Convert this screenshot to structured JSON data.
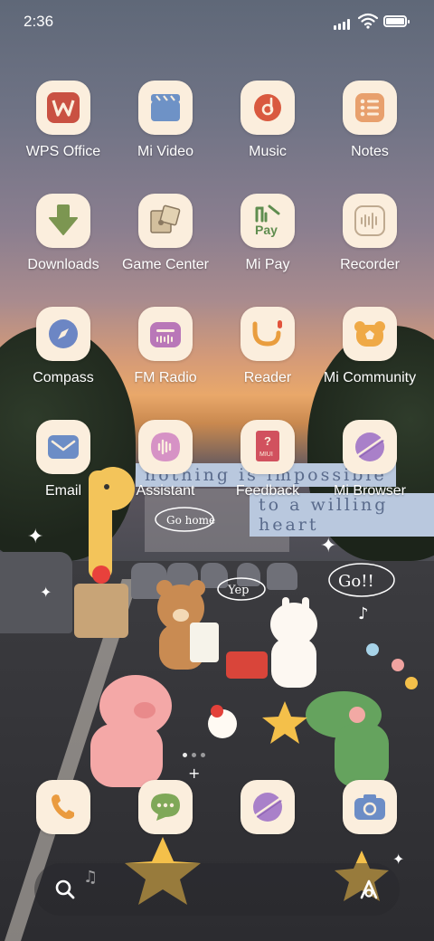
{
  "status_bar": {
    "time": "2:36"
  },
  "apps": [
    {
      "label": "WPS Office",
      "icon": "wps-office-icon"
    },
    {
      "label": "Mi Video",
      "icon": "clapperboard-icon"
    },
    {
      "label": "Music",
      "icon": "music-disc-icon"
    },
    {
      "label": "Notes",
      "icon": "notes-list-icon"
    },
    {
      "label": "Downloads",
      "icon": "download-arrow-icon"
    },
    {
      "label": "Game Center",
      "icon": "puzzle-icon"
    },
    {
      "label": "Mi Pay",
      "icon": "mi-pay-icon",
      "text": "Pay"
    },
    {
      "label": "Recorder",
      "icon": "waveform-icon"
    },
    {
      "label": "Compass",
      "icon": "compass-icon"
    },
    {
      "label": "FM Radio",
      "icon": "radio-icon"
    },
    {
      "label": "Reader",
      "icon": "reader-smile-icon"
    },
    {
      "label": "Mi Community",
      "icon": "bear-face-icon"
    },
    {
      "label": "Email",
      "icon": "envelope-icon"
    },
    {
      "label": "Assistant",
      "icon": "voice-assistant-icon"
    },
    {
      "label": "Feedback",
      "icon": "feedback-book-icon",
      "text": "MIUI"
    },
    {
      "label": "Mi Browser",
      "icon": "browser-planet-icon"
    }
  ],
  "dock": [
    {
      "name": "phone",
      "icon": "phone-icon"
    },
    {
      "name": "messages",
      "icon": "chat-bubble-icon"
    },
    {
      "name": "browser",
      "icon": "browser-planet-icon"
    },
    {
      "name": "camera",
      "icon": "camera-icon"
    }
  ],
  "wallpaper": {
    "banner_lines": [
      "nothing is impossible",
      "to a willing heart"
    ],
    "bubbles": [
      "Go home",
      "Yep",
      "Go!!"
    ]
  },
  "colors": {
    "tile": "#fbeedd",
    "label": "#ffffff"
  }
}
